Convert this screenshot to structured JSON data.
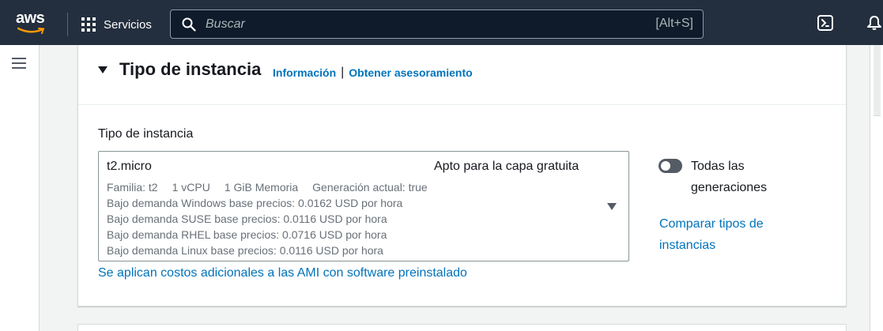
{
  "nav": {
    "logo_text": "aws",
    "services_label": "Servicios",
    "search_placeholder": "Buscar",
    "search_shortcut": "[Alt+S]",
    "icons": [
      "grid-icon",
      "search-icon",
      "cloudshell-icon",
      "bell-icon"
    ]
  },
  "card": {
    "title": "Tipo de instancia",
    "info_link": "Información",
    "separator": "|",
    "advice_link": "Obtener asesoramiento",
    "field_label": "Tipo de instancia",
    "selected": {
      "name": "t2.micro",
      "tag": "Apto para la capa gratuita",
      "family": "Familia: t2",
      "vcpu": "1 vCPU",
      "memory": "1 GiB Memoria",
      "generation": "Generación actual: true",
      "pricing": [
        "Bajo demanda Windows base precios: 0.0162 USD por hora",
        "Bajo demanda SUSE base precios: 0.0116 USD por hora",
        "Bajo demanda RHEL base precios: 0.0716 USD por hora",
        "Bajo demanda Linux base precios: 0.0116 USD por hora"
      ]
    },
    "toggle_label": "Todas las generaciones",
    "toggle_on": false,
    "compare_link": "Comparar tipos de instancias",
    "ami_note": "Se aplican costos adicionales a las AMI con software preinstalado"
  },
  "colors": {
    "nav_bg": "#232f3e",
    "link": "#0073bb",
    "aws_orange": "#ff9900"
  }
}
